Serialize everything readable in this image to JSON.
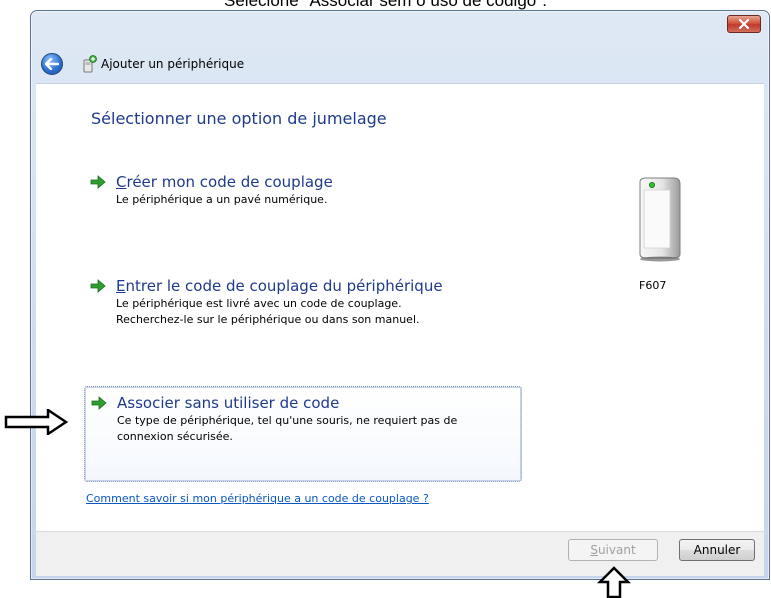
{
  "caption": "Selecione \"Associar sem o uso de código\".",
  "window": {
    "title": "Ajouter un périphérique",
    "close_symbol": "✕"
  },
  "content": {
    "heading": "Sélectionner une option de jumelage",
    "options": [
      {
        "title_first": "C",
        "title_rest": "réer mon code de couplage",
        "desc": [
          "Le périphérique a un pavé numérique."
        ],
        "selected": false,
        "icon": "green-arrow-icon"
      },
      {
        "title_first": "E",
        "title_rest": "ntrer le code de couplage du périphérique",
        "desc": [
          "Le périphérique est livré avec un code de couplage.",
          "Recherchez-le sur le périphérique ou dans son manuel."
        ],
        "selected": false,
        "icon": "green-arrow-icon"
      },
      {
        "title_first": "",
        "title_rest": "Associer sans utiliser de code",
        "desc": [
          "Ce type de périphérique, tel qu'une souris, ne requiert pas de",
          "connexion sécurisée."
        ],
        "selected": true,
        "icon": "green-arrow-icon"
      }
    ],
    "device": {
      "label": "F607",
      "icon": "pc-tower-icon"
    },
    "help_link": "Comment savoir si mon périphérique a un code de couplage ?"
  },
  "footer": {
    "next_first": "S",
    "next_rest": "uivant",
    "next_enabled": false,
    "cancel": "Annuler"
  },
  "colors": {
    "heading": "#1e3a8c",
    "link": "#0a57c2",
    "close_button": "#c0392b",
    "arrow_green": "#2e9e2e"
  }
}
